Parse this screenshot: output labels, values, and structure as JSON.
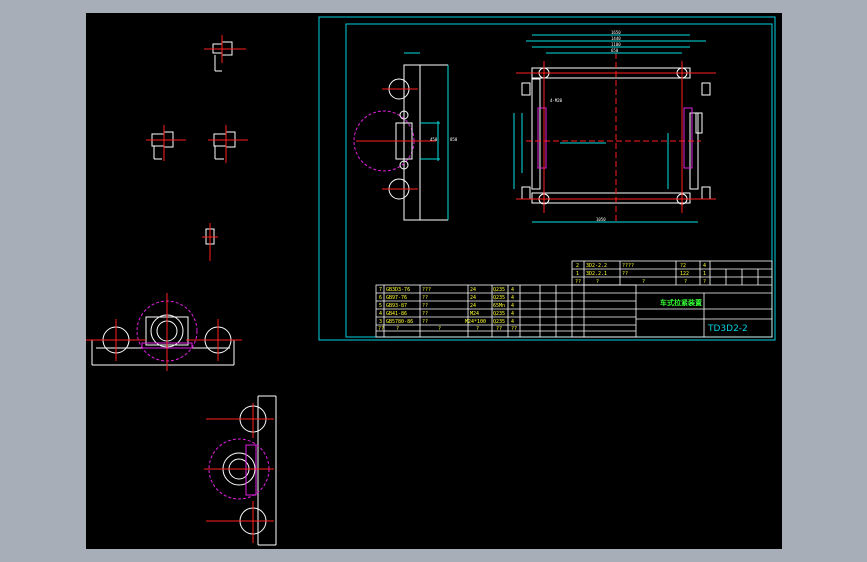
{
  "viewport": {
    "background": "#000000"
  },
  "colors": {
    "frame": "#00d0e0",
    "outline": "#ffffff",
    "center_line": "#ff2020",
    "hidden_circle": "#e020e0",
    "dimension": "#00e0e0",
    "text_yellow": "#ffff33",
    "text_green": "#33ff33"
  },
  "title_block": {
    "title": "车式拉紧装置",
    "drawing_number": "TD3D2-2"
  },
  "bom_left": [
    {
      "no": "7",
      "code": "GB3D3-76",
      "name": "???",
      "qty": "24",
      "mat": "Q235",
      "w": "4"
    },
    {
      "no": "6",
      "code": "GB97-76",
      "name": "??",
      "qty": "24",
      "mat": "Q235",
      "w": "4"
    },
    {
      "no": "5",
      "code": "GB93-87",
      "name": "??",
      "qty": "24",
      "mat": "65Mn",
      "w": "4"
    },
    {
      "no": "4",
      "code": "GB41-86",
      "name": "??",
      "qty": "M24",
      "mat": "Q235",
      "w": "4"
    },
    {
      "no": "3",
      "code": "GB5780-86",
      "name": "??",
      "qty": "M24*100",
      "mat": "Q235",
      "w": "4"
    },
    {
      "no": "??",
      "code": "?",
      "name": "?",
      "qty": "?",
      "mat": "??",
      "w": "??"
    }
  ],
  "bom_right": [
    {
      "no": "2",
      "code": "3D2-2.2",
      "name": "????",
      "qty": "?2",
      "w": "4"
    },
    {
      "no": "1",
      "code": "3D2.2.1",
      "name": "??",
      "qty": "122",
      "w": "1"
    },
    {
      "no": "??",
      "code": "?",
      "name": "?",
      "qty": "?",
      "w": "?"
    }
  ],
  "dimensions": {
    "overall_top": [
      "1650",
      "1440",
      "1100",
      "650"
    ],
    "side_height": [
      "850",
      "450"
    ],
    "plan_width": "1050",
    "note": "4-M20"
  }
}
